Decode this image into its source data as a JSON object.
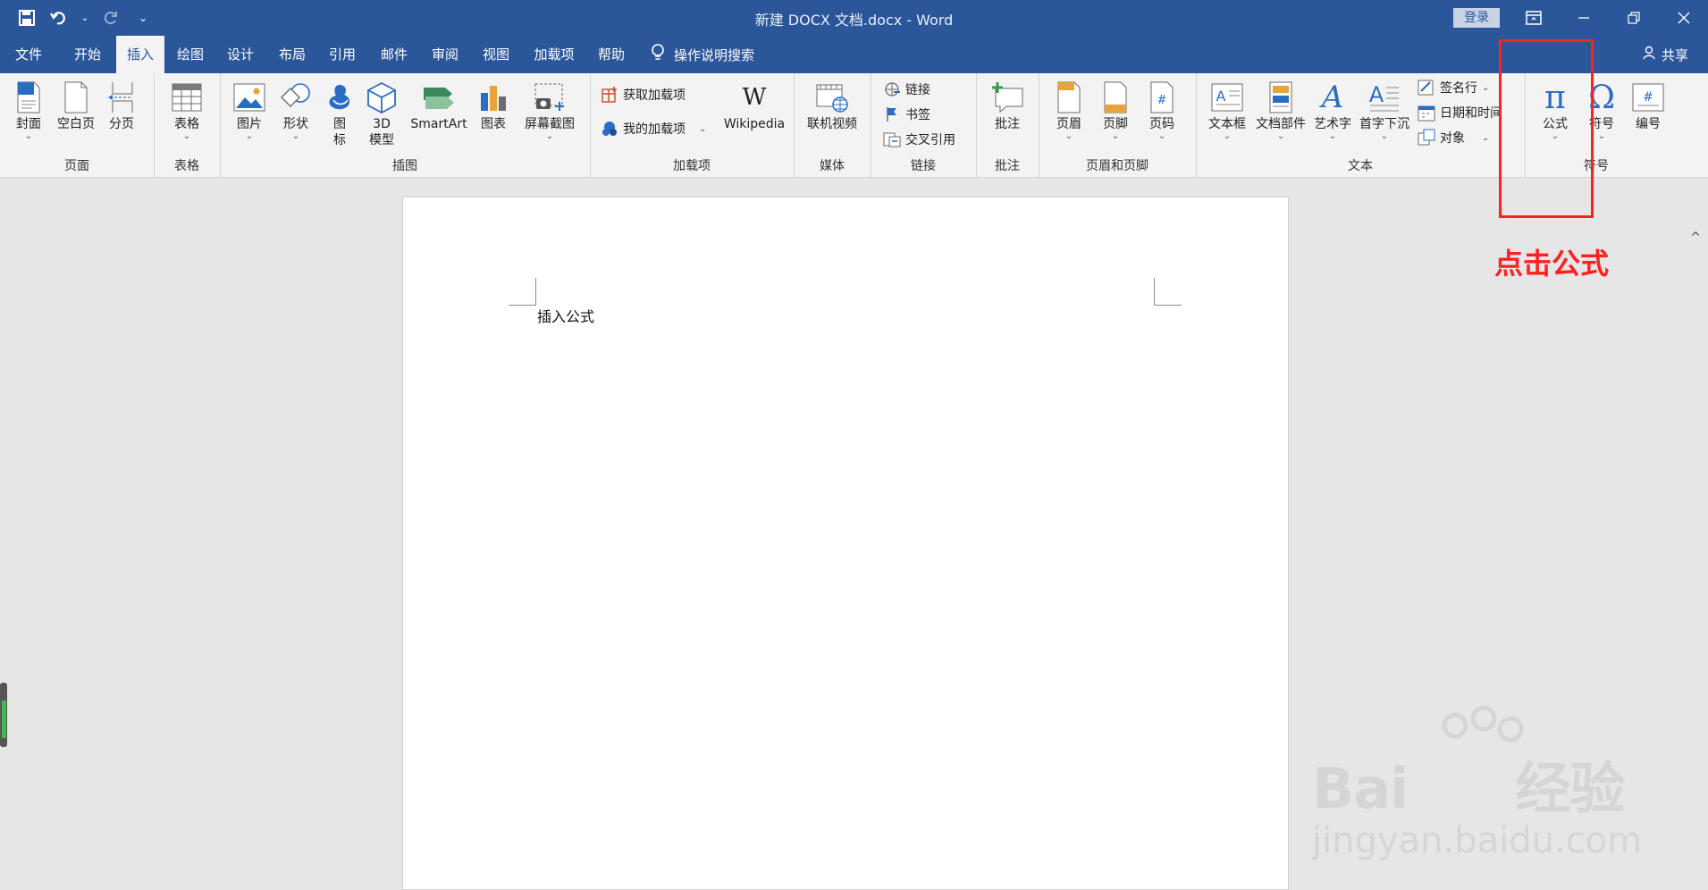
{
  "window": {
    "title": "新建 DOCX 文档.docx  -  Word",
    "login_label": "登录"
  },
  "tabs": [
    "文件",
    "开始",
    "插入",
    "绘图",
    "设计",
    "布局",
    "引用",
    "邮件",
    "审阅",
    "视图",
    "加载项",
    "帮助"
  ],
  "active_tab": "插入",
  "tell_me": "操作说明搜索",
  "share_label": "共享",
  "ribbon": {
    "pages": {
      "label": "页面",
      "cover": "封面",
      "blank": "空白页",
      "break": "分页"
    },
    "tables": {
      "label": "表格",
      "table": "表格"
    },
    "illustrations": {
      "label": "插图",
      "picture": "图片",
      "shapes": "形状",
      "icons_1": "图",
      "icons_2": "标",
      "model_1": "3D",
      "model_2": "模型",
      "smartart": "SmartArt",
      "chart": "图表",
      "screenshot": "屏幕截图"
    },
    "addins": {
      "label": "加载项",
      "get": "获取加载项",
      "mine": "我的加载项",
      "wikipedia": "Wikipedia"
    },
    "media": {
      "label": "媒体",
      "video": "联机视频"
    },
    "links": {
      "label": "链接",
      "link": "链接",
      "bookmark": "书签",
      "crossref": "交叉引用"
    },
    "comments": {
      "label": "批注",
      "comment": "批注"
    },
    "headerfooter": {
      "label": "页眉和页脚",
      "header": "页眉",
      "footer": "页脚",
      "pagenum": "页码"
    },
    "text": {
      "label": "文本",
      "textbox": "文本框",
      "quickparts": "文档部件",
      "wordart": "艺术字",
      "dropcap": "首字下沉",
      "signature": "签名行",
      "datetime": "日期和时间",
      "object": "对象"
    },
    "symbols": {
      "label": "符号",
      "equation": "公式",
      "symbol": "符号",
      "number": "编号"
    }
  },
  "document": {
    "text": "插入公式"
  },
  "annotation": {
    "text": "点击公式",
    "color": "#ff2020"
  },
  "watermark": {
    "brand": "Bai",
    "brand2": "经验",
    "url": "jingyan.baidu.com"
  },
  "colors": {
    "accent": "#2b579a",
    "ribbon_bg": "#f3f3f3"
  }
}
